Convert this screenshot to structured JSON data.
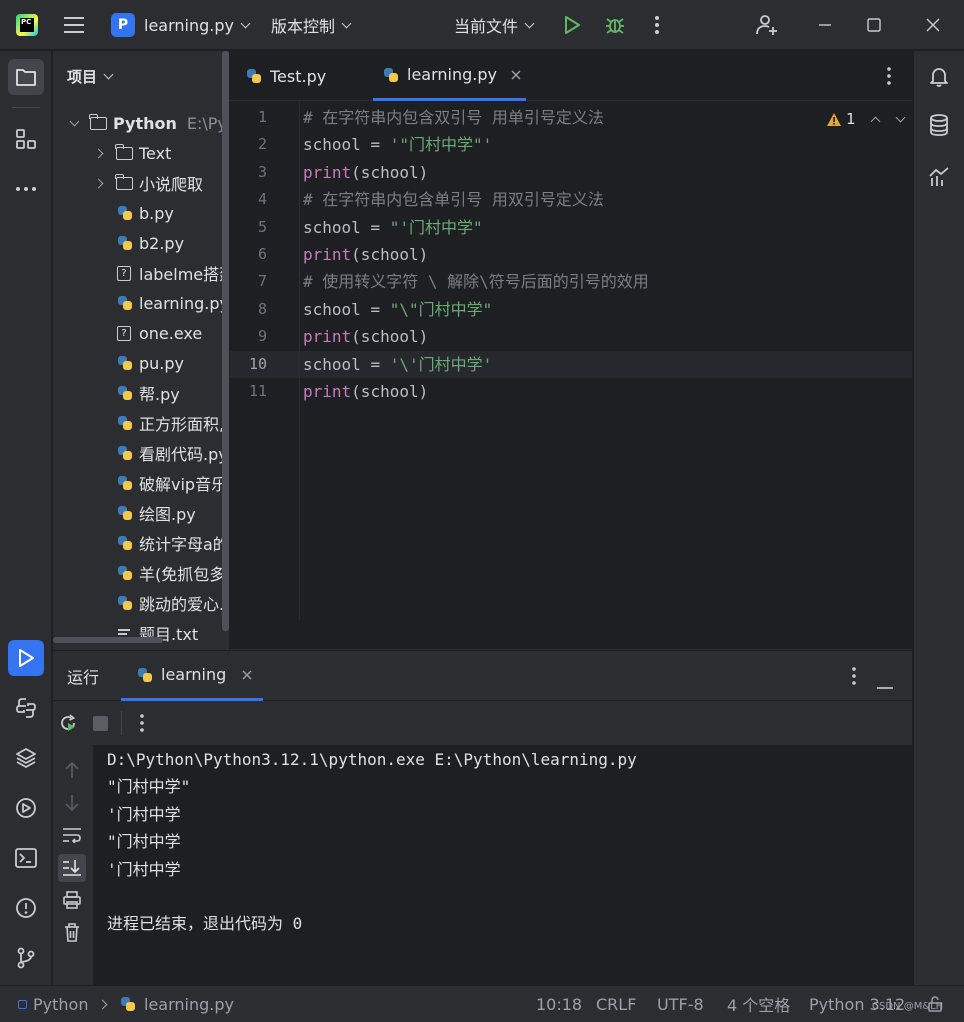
{
  "window": {
    "project_badge": "P",
    "project_name": "learning.py",
    "vcs_label": "版本控制",
    "run_config": "当前文件",
    "logo_text": "PC"
  },
  "project_panel": {
    "title": "项目",
    "root_name": "Python",
    "root_path": "E:\\Py",
    "items": [
      {
        "label": "Text",
        "type": "folder"
      },
      {
        "label": "小说爬取",
        "type": "folder"
      },
      {
        "label": "b.py",
        "type": "python"
      },
      {
        "label": "b2.py",
        "type": "python"
      },
      {
        "label": "labelme搭建",
        "type": "unknown"
      },
      {
        "label": "learning.py",
        "type": "python"
      },
      {
        "label": "one.exe",
        "type": "unknown"
      },
      {
        "label": "pu.py",
        "type": "python"
      },
      {
        "label": "帮.py",
        "type": "python"
      },
      {
        "label": "正方形面积,",
        "type": "python"
      },
      {
        "label": "看剧代码.py",
        "type": "python"
      },
      {
        "label": "破解vip音乐",
        "type": "python"
      },
      {
        "label": "绘图.py",
        "type": "python"
      },
      {
        "label": "统计字母a的",
        "type": "python"
      },
      {
        "label": "羊(免抓包多",
        "type": "python"
      },
      {
        "label": "跳动的爱心.p",
        "type": "python"
      },
      {
        "label": "题目.txt",
        "type": "text"
      }
    ]
  },
  "editor": {
    "tabs": [
      {
        "label": "Test.py",
        "active": false
      },
      {
        "label": "learning.py",
        "active": true
      }
    ],
    "warning_count": "1",
    "current_line": 10,
    "lines": [
      {
        "n": "1",
        "parts": [
          {
            "c": "cm",
            "t": "# 在字符串内包含双引号 用单引号定义法"
          }
        ]
      },
      {
        "n": "2",
        "parts": [
          {
            "c": "id",
            "t": "school "
          },
          {
            "c": "id",
            "t": "= "
          },
          {
            "c": "st",
            "t": "'\"门村中学\"'"
          }
        ]
      },
      {
        "n": "3",
        "parts": [
          {
            "c": "kw",
            "t": "print"
          },
          {
            "c": "id",
            "t": "(school)"
          }
        ]
      },
      {
        "n": "4",
        "parts": [
          {
            "c": "cm",
            "t": "# 在字符串内包含单引号 用双引号定义法"
          }
        ]
      },
      {
        "n": "5",
        "parts": [
          {
            "c": "id",
            "t": "school "
          },
          {
            "c": "id",
            "t": "= "
          },
          {
            "c": "st",
            "t": "\"'门村中学\""
          }
        ]
      },
      {
        "n": "6",
        "parts": [
          {
            "c": "kw",
            "t": "print"
          },
          {
            "c": "id",
            "t": "(school)"
          }
        ]
      },
      {
        "n": "7",
        "parts": [
          {
            "c": "cm",
            "t": "# 使用转义字符 \\ 解除\\符号后面的引号的效用"
          }
        ]
      },
      {
        "n": "8",
        "parts": [
          {
            "c": "id",
            "t": "school "
          },
          {
            "c": "id",
            "t": "= "
          },
          {
            "c": "st",
            "t": "\"\\\"门村中学\""
          }
        ]
      },
      {
        "n": "9",
        "parts": [
          {
            "c": "kw",
            "t": "print"
          },
          {
            "c": "id",
            "t": "(school)"
          }
        ]
      },
      {
        "n": "10",
        "parts": [
          {
            "c": "id",
            "t": "school "
          },
          {
            "c": "id",
            "t": "= "
          },
          {
            "c": "st",
            "t": "'\\'门村中学'"
          }
        ]
      },
      {
        "n": "11",
        "parts": [
          {
            "c": "kw",
            "t": "print"
          },
          {
            "c": "id",
            "t": "(school)"
          }
        ]
      }
    ]
  },
  "run_panel": {
    "title": "运行",
    "tab_label": "learning",
    "console_lines": [
      "D:\\Python\\Python3.12.1\\python.exe E:\\Python\\learning.py",
      "\"门村中学\"",
      "'门村中学",
      "\"门村中学",
      "'门村中学",
      "",
      "进程已结束，退出代码为 0"
    ]
  },
  "status_bar": {
    "project": "Python",
    "file": "learning.py",
    "position": "10:18",
    "line_ending": "CRLF",
    "encoding": "UTF-8",
    "indent": "4 个空格",
    "interpreter": "Python 3.12",
    "watermark": "CSDN @M&LH"
  },
  "colors": {
    "accent": "#3574f0",
    "string": "#6aab73",
    "keyword": "#c77dbb",
    "comment": "#7a7e85",
    "run_green": "#5fb865",
    "warning": "#e2a53a"
  },
  "icons": [
    "pycharm-logo-icon",
    "hamburger-menu-icon",
    "run-icon",
    "debug-bug-icon",
    "more-vertical-icon",
    "add-user-icon",
    "minimize-icon",
    "maximize-icon",
    "close-icon",
    "folder-icon",
    "structure-icon",
    "more-horizontal-icon",
    "run-tool-icon",
    "python-console-icon",
    "layers-icon",
    "services-icon",
    "terminal-icon",
    "problems-icon",
    "git-icon",
    "bell-icon",
    "database-icon",
    "sciview-icon",
    "rerun-icon",
    "stop-icon",
    "arrow-up-icon",
    "arrow-down-icon",
    "soft-wrap-icon",
    "scroll-to-end-icon",
    "print-icon",
    "trash-icon",
    "lock-icon"
  ]
}
